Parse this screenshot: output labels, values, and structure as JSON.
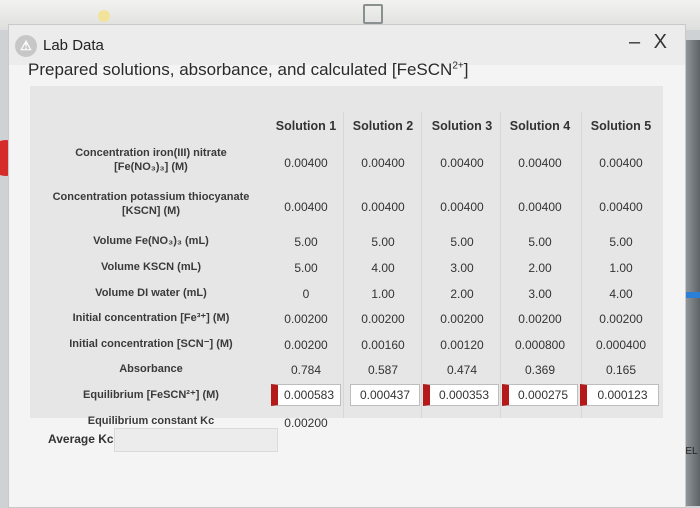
{
  "window": {
    "title": "Lab Data",
    "minimize": "–",
    "close": "X",
    "icon": "app-badge-icon"
  },
  "heading": {
    "text": "Prepared solutions, absorbance, and calculated [FeSCN",
    "sup": "2+",
    "end": "]"
  },
  "columns": [
    "Solution 1",
    "Solution 2",
    "Solution 3",
    "Solution 4",
    "Solution 5"
  ],
  "rows": [
    {
      "l1": "Concentration iron(III) nitrate",
      "l2": "[Fe(NO₃)₃] (M)"
    },
    {
      "l1": "Concentration potassium thiocyanate",
      "l2": "[KSCN] (M)"
    },
    {
      "l1": "Volume Fe(NO₃)₃ (mL)",
      "l2": ""
    },
    {
      "l1": "Volume KSCN (mL)",
      "l2": ""
    },
    {
      "l1": "Volume DI water (mL)",
      "l2": ""
    },
    {
      "l1": "Initial concentration [Fe³⁺] (M)",
      "l2": ""
    },
    {
      "l1": "Initial concentration [SCN⁻] (M)",
      "l2": ""
    },
    {
      "l1": "Absorbance",
      "l2": ""
    },
    {
      "l1": "Equilibrium [FeSCN²⁺] (M)",
      "l2": ""
    },
    {
      "l1": "Equilibrium constant Kc",
      "l2": ""
    }
  ],
  "values": {
    "fe_conc": [
      "0.00400",
      "0.00400",
      "0.00400",
      "0.00400",
      "0.00400"
    ],
    "kscn_conc": [
      "0.00400",
      "0.00400",
      "0.00400",
      "0.00400",
      "0.00400"
    ],
    "vol_fe": [
      "5.00",
      "5.00",
      "5.00",
      "5.00",
      "5.00"
    ],
    "vol_kscn": [
      "5.00",
      "4.00",
      "3.00",
      "2.00",
      "1.00"
    ],
    "vol_water": [
      "0",
      "1.00",
      "2.00",
      "3.00",
      "4.00"
    ],
    "init_fe": [
      "0.00200",
      "0.00200",
      "0.00200",
      "0.00200",
      "0.00200"
    ],
    "init_scn": [
      "0.00200",
      "0.00160",
      "0.00120",
      "0.000800",
      "0.000400"
    ],
    "absorbance": [
      "0.784",
      "0.587",
      "0.474",
      "0.369",
      "0.165"
    ],
    "eq_fescn": [
      "0.000583",
      "0.000437",
      "0.000353",
      "0.000275",
      "0.000123"
    ],
    "kc": [
      "0.00200"
    ]
  },
  "average": {
    "label": "Average Kc",
    "value": ""
  },
  "background": {
    "right_edge_text": "ABEL"
  },
  "colors": {
    "flag": "#b51a1a",
    "window_bg": "#f4f4f4",
    "grid_bg": "#e6e6e6"
  }
}
